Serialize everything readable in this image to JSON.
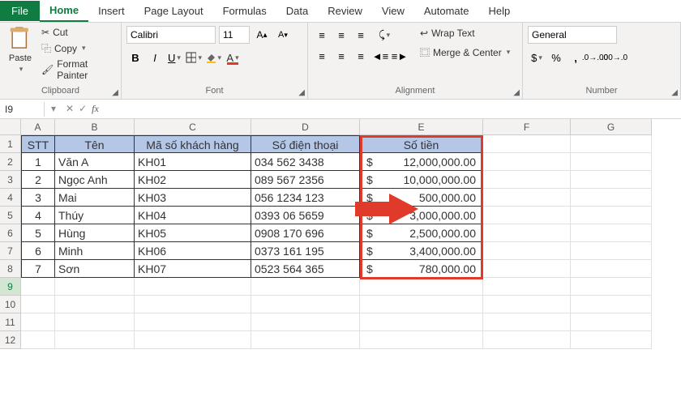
{
  "tabs": {
    "file": "File",
    "home": "Home",
    "insert": "Insert",
    "pageLayout": "Page Layout",
    "formulas": "Formulas",
    "data": "Data",
    "review": "Review",
    "view": "View",
    "automate": "Automate",
    "help": "Help"
  },
  "clipboard": {
    "paste": "Paste",
    "cut": "Cut",
    "copy": "Copy",
    "formatPainter": "Format Painter",
    "label": "Clipboard"
  },
  "font": {
    "name": "Calibri",
    "size": "11",
    "label": "Font"
  },
  "alignment": {
    "wrap": "Wrap Text",
    "merge": "Merge & Center",
    "label": "Alignment"
  },
  "number": {
    "format": "General",
    "label": "Number"
  },
  "nameBox": "I9",
  "columns": [
    "A",
    "B",
    "C",
    "D",
    "E",
    "F",
    "G"
  ],
  "rowNums": [
    "1",
    "2",
    "3",
    "4",
    "5",
    "6",
    "7",
    "8",
    "9",
    "10",
    "11",
    "12"
  ],
  "headers": {
    "stt": "STT",
    "ten": "Tên",
    "ma": "Mã số khách hàng",
    "sdt": "Số điện thoại",
    "tien": "Số tiền"
  },
  "rows": [
    {
      "stt": "1",
      "ten": "Văn A",
      "ma": "KH01",
      "sdt": "034 562 3438",
      "cur": "$",
      "amt": "12,000,000.00"
    },
    {
      "stt": "2",
      "ten": "Ngọc Anh",
      "ma": "KH02",
      "sdt": "089 567 2356",
      "cur": "$",
      "amt": "10,000,000.00"
    },
    {
      "stt": "3",
      "ten": "Mai",
      "ma": "KH03",
      "sdt": "056 1234 123",
      "cur": "$",
      "amt": "500,000.00"
    },
    {
      "stt": "4",
      "ten": "Thúy",
      "ma": "KH04",
      "sdt": "0393 06 5659",
      "cur": "$",
      "amt": "3,000,000.00"
    },
    {
      "stt": "5",
      "ten": "Hùng",
      "ma": "KH05",
      "sdt": "0908 170 696",
      "cur": "$",
      "amt": "2,500,000.00"
    },
    {
      "stt": "6",
      "ten": "Minh",
      "ma": "KH06",
      "sdt": "0373 161 195",
      "cur": "$",
      "amt": "3,400,000.00"
    },
    {
      "stt": "7",
      "ten": "Sơn",
      "ma": "KH07",
      "sdt": "0523 564 365",
      "cur": "$",
      "amt": "780,000.00"
    }
  ]
}
